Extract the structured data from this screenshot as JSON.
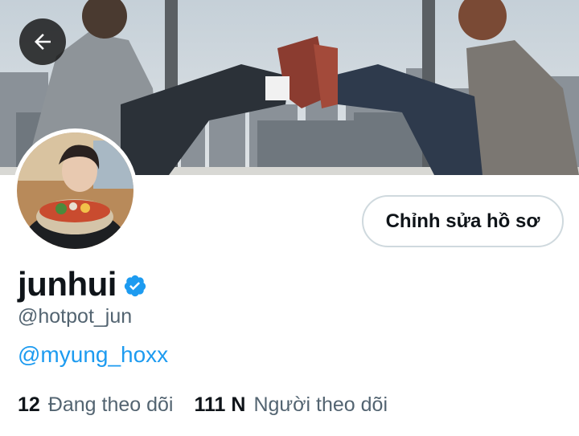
{
  "profile": {
    "display_name": "junhui",
    "handle": "@hotpot_jun",
    "bio_link": "@myung_hoxx",
    "verified": true
  },
  "actions": {
    "edit_profile_label": "Chỉnh sửa hồ sơ"
  },
  "stats": {
    "following_count": "12",
    "following_label": "Đang theo dõi",
    "followers_count": "111 N",
    "followers_label": "Người theo dõi"
  },
  "icons": {
    "back": "arrow-left-icon",
    "verified": "verified-badge-icon"
  },
  "colors": {
    "accent": "#1d9bf0",
    "text_primary": "#0f1419",
    "text_secondary": "#536471",
    "border": "#cfd9de"
  }
}
